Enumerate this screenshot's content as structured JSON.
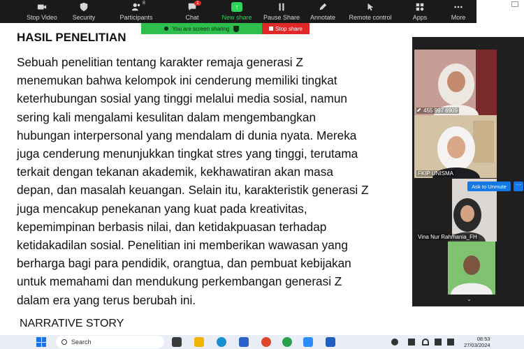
{
  "toolbar": {
    "buttons": [
      {
        "label": "Stop Video",
        "icon": "video-camera-icon"
      },
      {
        "label": "Security",
        "icon": "shield-icon"
      },
      {
        "label": "Participants",
        "icon": "participants-icon"
      },
      {
        "label": "Chat",
        "icon": "chat-icon"
      },
      {
        "label": "New share",
        "icon": "new-share-icon"
      },
      {
        "label": "Pause Share",
        "icon": "pause-icon"
      },
      {
        "label": "Annotate",
        "icon": "pen-icon"
      },
      {
        "label": "Remote control",
        "icon": "remote-control-icon"
      },
      {
        "label": "Apps",
        "icon": "apps-icon"
      },
      {
        "label": "More",
        "icon": "more-icon"
      }
    ],
    "participants_count": "8",
    "chat_badge": "1",
    "new_share_accent": "#2dd35a"
  },
  "share_banner": {
    "status": "You are screen sharing",
    "stop_label": "Stop share",
    "status_color": "#2dbe4c",
    "stop_color": "#e02828"
  },
  "document": {
    "title": "HASIL PENELITIAN",
    "lines": [
      "Sebuah penelitian tentang karakter remaja generasi Z",
      "menemukan bahwa kelompok ini cenderung memiliki tingkat",
      "keterhubungan sosial yang tinggi melalui media sosial, namun",
      "sering kali mengalami kesulitan dalam mengembangkan",
      "hubungan interpersonal yang mendalam di dunia nyata. Mereka",
      "juga cenderung menunjukkan tingkat stres yang tinggi, terutama",
      "terkait dengan tekanan akademik, kekhawatiran akan masa",
      "depan, dan masalah keuangan. Selain itu, karakteristik generasi Z",
      "juga mencakup penekanan yang kuat pada kreativitas,",
      "kepemimpinan berbasis nilai, dan ketidakpuasan terhadap",
      "ketidakadilan sosial. Penelitian ini memberikan wawasan yang",
      "berharga bagi para pendidik, orangtua, dan pembuat kebijakan",
      "untuk memahami dan mendukung perkembangan generasi Z",
      "dalam era yang terus berubah ini."
    ],
    "next_heading": "NARRATIVE STORY"
  },
  "participants": {
    "tiles": [
      {
        "name": "455 997 6909",
        "bg": "#b98a7e"
      },
      {
        "name": "FKIP UNISMA",
        "bg": "#b5a591"
      },
      {
        "name": "Vina Nur Rahmania_FH",
        "bg": "#d9d3cc"
      },
      {
        "name": "",
        "bg": "#6fa86a"
      }
    ],
    "ask_to_unmute": "Ask to Unmute",
    "more": "···"
  },
  "taskbar": {
    "search_placeholder": "Search",
    "time": "08:53",
    "date": "27/03/2024"
  }
}
